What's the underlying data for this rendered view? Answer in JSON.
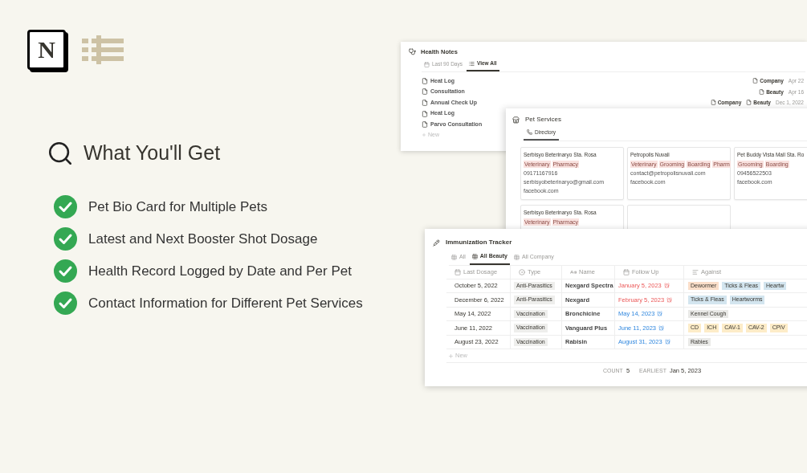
{
  "logo": {
    "letter": "N"
  },
  "heading": "What You'll Get",
  "features": [
    "Pet Bio Card for Multiple Pets",
    "Latest and Next Booster Shot Dosage",
    "Health Record Logged by Date and Per Pet",
    "Contact Information for Different Pet Services"
  ],
  "health_notes": {
    "title": "Health Notes",
    "tabs": [
      {
        "label": "Last 90 Days",
        "kind": "calendar",
        "selected": false
      },
      {
        "label": "View All",
        "kind": "list",
        "selected": true
      }
    ],
    "items": [
      {
        "title": "Heat Log",
        "tags": [
          "Company"
        ],
        "date": "Apr 22"
      },
      {
        "title": "Consultation",
        "tags": [
          "Beauty"
        ],
        "date": "Apr 16"
      },
      {
        "title": "Annual Check Up",
        "tags": [
          "Company",
          "Beauty"
        ],
        "date": "Dec 1, 2022"
      },
      {
        "title": "Heat Log"
      },
      {
        "title": "Parvo Consultation"
      }
    ],
    "new_label": "New"
  },
  "pet_services": {
    "title": "Pet Services",
    "tabs": [
      {
        "label": "Directory",
        "selected": true
      }
    ],
    "cards": [
      {
        "kind": "entry",
        "name": "Serbisyo Beterinaryo Sta. Rosa",
        "tags": [
          "Veterinary",
          "Pharmacy"
        ],
        "lines": [
          "09171167916",
          "serbisyobeterinaryo@gmail.com",
          "facebook.com"
        ]
      },
      {
        "kind": "entry",
        "name": "Petropolis Nuvali",
        "tags": [
          "Veterinary",
          "Grooming",
          "Boarding",
          "Pharm"
        ],
        "lines": [
          "contact@petropolisnuvali.com",
          "facebook.com"
        ]
      },
      {
        "kind": "entry",
        "name": "Pet Buddy Vista Mall Sta. Ro",
        "tags": [
          "Grooming",
          "Boarding"
        ],
        "lines": [
          "09456522503",
          "facebook.com"
        ]
      },
      {
        "kind": "entry",
        "name": "Serbisyo Beterinaryo Sta. Rosa",
        "tags": [
          "Veterinary",
          "Pharmacy"
        ]
      },
      {
        "kind": "blank"
      }
    ]
  },
  "immunization": {
    "title": "Immunization Tracker",
    "tabs": [
      {
        "label": "All",
        "selected": false
      },
      {
        "label": "All Beauty",
        "selected": true
      },
      {
        "label": "All Company",
        "selected": false
      }
    ],
    "columns": [
      {
        "label": "Last Dosage",
        "kind": "date"
      },
      {
        "label": "Type",
        "kind": "select"
      },
      {
        "label": "Name",
        "kind": "title"
      },
      {
        "label": "Follow Up",
        "kind": "date"
      },
      {
        "label": "Against",
        "kind": "multi"
      }
    ],
    "rows": [
      {
        "last_dosage": "October 5, 2022",
        "type": "Anti-Parasitics",
        "name": "Nexgard Spectra",
        "follow_up": "January 5, 2023",
        "overdue": true,
        "against": [
          {
            "label": "Dewormer",
            "color": "#fadec9"
          },
          {
            "label": "Ticks & Fleas",
            "color": "#d3e5ef"
          },
          {
            "label": "Heartw",
            "color": "#d3e5ef"
          }
        ]
      },
      {
        "last_dosage": "December 6, 2022",
        "type": "Anti-Parasitics",
        "name": "Nexgard",
        "follow_up": "February 5, 2023",
        "overdue": true,
        "against": [
          {
            "label": "Ticks & Fleas",
            "color": "#d3e5ef"
          },
          {
            "label": "Heartworms",
            "color": "#d3e5ef"
          }
        ]
      },
      {
        "last_dosage": "May 14, 2022",
        "type": "Vaccination",
        "name": "Bronchicine",
        "follow_up": "May 14, 2023",
        "overdue": false,
        "against": [
          {
            "label": "Kennel Cough",
            "color": "#e9e9e7"
          }
        ]
      },
      {
        "last_dosage": "June 11, 2022",
        "type": "Vaccination",
        "name": "Vanguard Plus",
        "follow_up": "June 11, 2023",
        "overdue": false,
        "against": [
          {
            "label": "CD",
            "color": "#fdecc8"
          },
          {
            "label": "ICH",
            "color": "#fdecc8"
          },
          {
            "label": "CAV-1",
            "color": "#fdecc8"
          },
          {
            "label": "CAV-2",
            "color": "#fdecc8"
          },
          {
            "label": "CPiV",
            "color": "#fdecc8"
          }
        ]
      },
      {
        "last_dosage": "August 23, 2022",
        "type": "Vaccination",
        "name": "Rabisin",
        "follow_up": "August 31, 2023",
        "overdue": false,
        "against": [
          {
            "label": "Rabies",
            "color": "#e9e9e7"
          }
        ]
      }
    ],
    "new_label": "New",
    "footer": {
      "count_label": "COUNT",
      "count": "5",
      "earliest_label": "EARLIEST",
      "earliest": "Jan 5, 2023"
    }
  }
}
